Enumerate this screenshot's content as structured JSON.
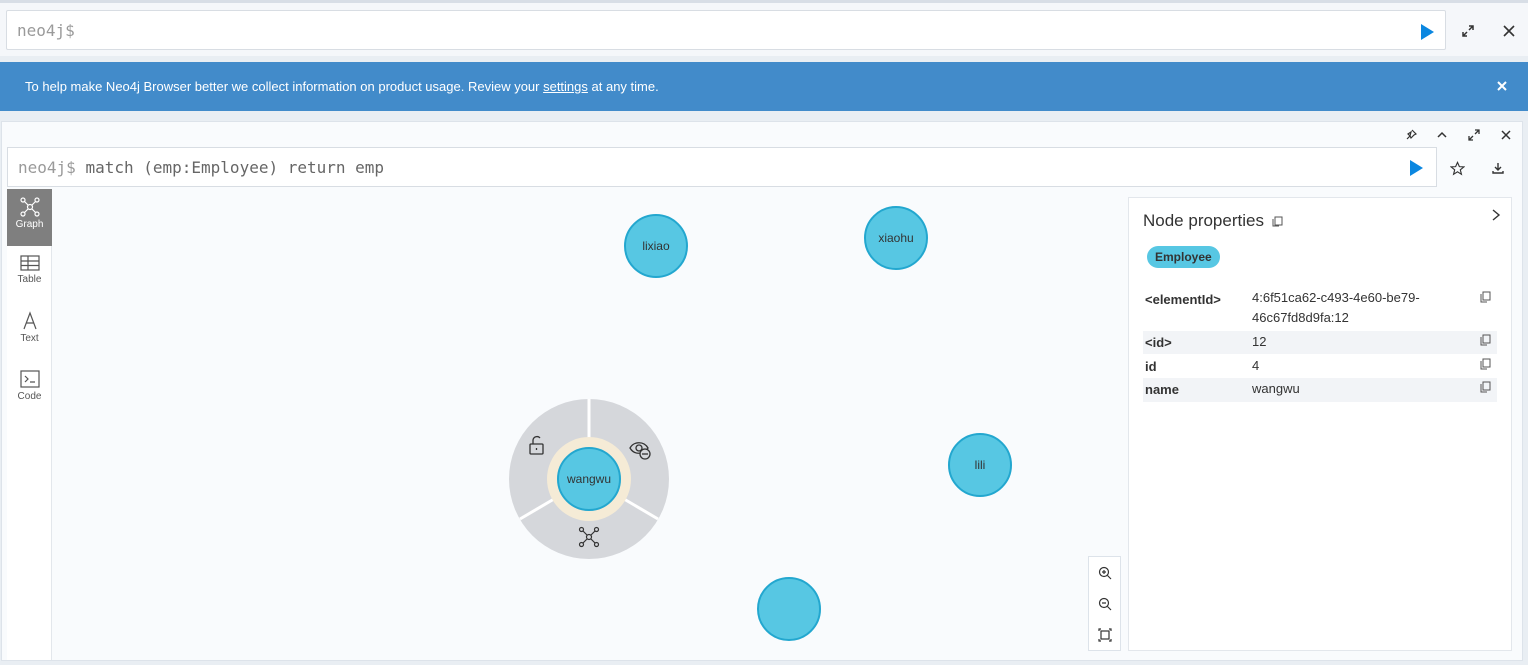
{
  "top_editor": {
    "prompt": "neo4j$"
  },
  "banner": {
    "text_before": "To help make Neo4j Browser better we collect information on product usage. Review your ",
    "link": "settings",
    "text_after": " at any time."
  },
  "frame": {
    "prompt": "neo4j$",
    "query": "match (emp:Employee) return emp"
  },
  "side_tabs": [
    {
      "label": "Graph",
      "icon": "graph-icon",
      "active": true
    },
    {
      "label": "Table",
      "icon": "table-icon"
    },
    {
      "label": "Text",
      "icon": "text-icon"
    },
    {
      "label": "Code",
      "icon": "code-icon"
    }
  ],
  "nodes": {
    "lixiao": "lixiao",
    "xiaohu": "xiaohu",
    "lili": "lili",
    "wangwu": "wangwu",
    "unlabeled": ""
  },
  "properties": {
    "title": "Node properties",
    "label": "Employee",
    "rows": [
      {
        "key": "<elementId>",
        "value": "4:6f51ca62-c493-4e60-be79-46c67fd8d9fa:12"
      },
      {
        "key": "<id>",
        "value": "12"
      },
      {
        "key": "id",
        "value": "4"
      },
      {
        "key": "name",
        "value": "wangwu"
      }
    ]
  },
  "colors": {
    "node_fill": "#57c7e3",
    "node_stroke": "#23a7cf",
    "banner": "#428bca",
    "run_button": "#0b87e0",
    "ring": "#d5d7db",
    "selected_halo": "#f5ebd6"
  }
}
